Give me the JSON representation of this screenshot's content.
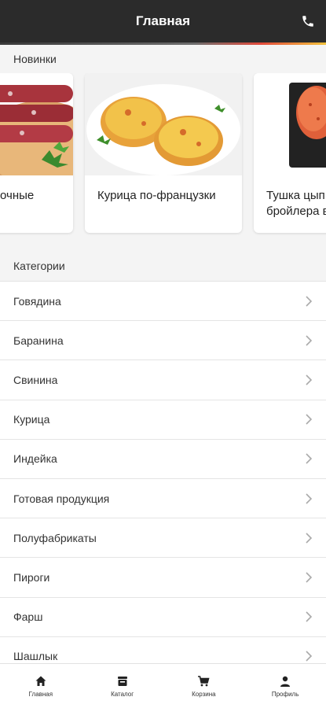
{
  "header": {
    "title": "Главная",
    "phone_icon": "phone-icon"
  },
  "new_section": {
    "title": "Новинки",
    "cards": [
      {
        "name": "очные"
      },
      {
        "name": "Курица по-французки"
      },
      {
        "name": "Тушка цып\nбройлера в"
      }
    ]
  },
  "categories_section": {
    "title": "Категории",
    "items": [
      {
        "label": "Говядина"
      },
      {
        "label": "Баранина"
      },
      {
        "label": "Свинина"
      },
      {
        "label": "Курица"
      },
      {
        "label": "Индейка"
      },
      {
        "label": "Готовая продукция"
      },
      {
        "label": "Полуфабрикаты"
      },
      {
        "label": "Пироги"
      },
      {
        "label": "Фарш"
      },
      {
        "label": "Шашлык"
      }
    ]
  },
  "bottom_nav": {
    "items": [
      {
        "label": "Главная",
        "icon": "home-icon"
      },
      {
        "label": "Каталог",
        "icon": "catalog-icon"
      },
      {
        "label": "Корзина",
        "icon": "cart-icon"
      },
      {
        "label": "Профиль",
        "icon": "profile-icon"
      }
    ]
  },
  "colors": {
    "header_bg": "#2b2b2b",
    "accent_red": "#e24a3b",
    "accent_yellow": "#f2c23b"
  }
}
